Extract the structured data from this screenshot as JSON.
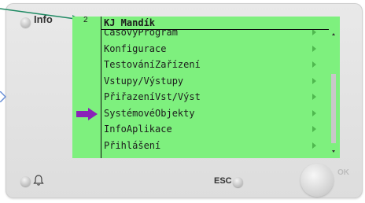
{
  "header": {
    "info_label": "Info",
    "screen_number": "2",
    "title": "KJ Mandík"
  },
  "menu": {
    "items": [
      {
        "label": "CasovyProgram"
      },
      {
        "label": "Konfigurace"
      },
      {
        "label": "TestováníZařízení"
      },
      {
        "label": "Vstupy/Výstupy"
      },
      {
        "label": "PřiřazeníVst/Výst"
      },
      {
        "label": "SystémovéObjekty"
      },
      {
        "label": "InfoAplikace"
      },
      {
        "label": "Přihlášení"
      }
    ]
  },
  "controls": {
    "esc_label": "ESC",
    "ok_label": "OK"
  },
  "colors": {
    "screen_bg": "#7ef07e",
    "menu_arrow": "#4fb84f",
    "pointer_line": "#1f8a63",
    "highlight_arrow": "#8a22b8",
    "left_chevron": "#6a8fd6"
  },
  "icons": {
    "bell": "bell-icon",
    "highlight": "purple-arrow-icon",
    "pointer": "green-pointer-arrow"
  }
}
